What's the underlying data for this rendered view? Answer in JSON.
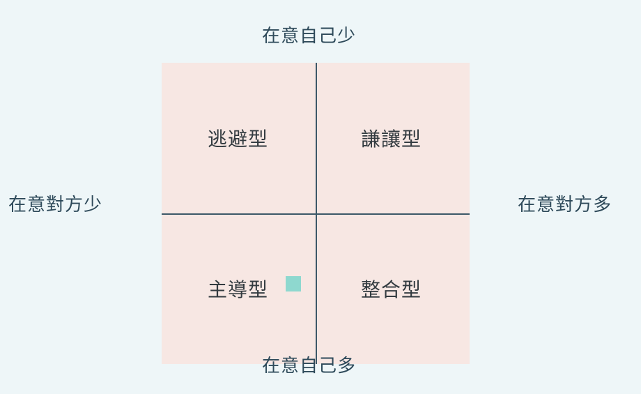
{
  "axes": {
    "top": "在意自己少",
    "bottom": "在意自己多",
    "left": "在意對方少",
    "right": "在意對方多"
  },
  "quadrants": {
    "top_left": "逃避型",
    "top_right": "謙讓型",
    "bottom_left": "主導型",
    "bottom_right": "整合型"
  },
  "colors": {
    "background": "#eef6f8",
    "grid_fill": "#f7e7e3",
    "axis_line": "#3c5868",
    "text": "#2e4a5a",
    "marker": "#8ed8cf"
  }
}
